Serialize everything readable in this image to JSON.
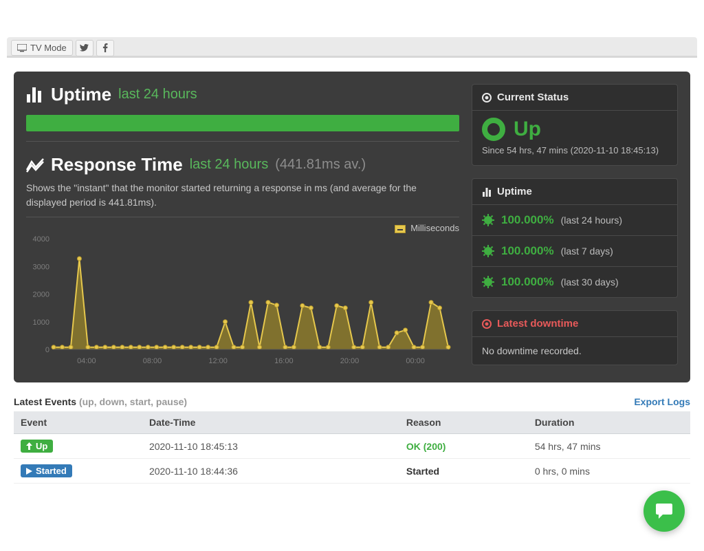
{
  "topbar": {
    "tv_mode": "TV Mode"
  },
  "uptime": {
    "title": "Uptime",
    "range": "last 24 hours"
  },
  "response": {
    "title": "Response Time",
    "range": "last 24 hours",
    "avg": "(441.81ms av.)",
    "desc": "Shows the \"instant\" that the monitor started returning a response in ms (and average for the displayed period is 441.81ms).",
    "legend": "Milliseconds"
  },
  "status": {
    "head": "Current Status",
    "label": "Up",
    "since": "Since 54 hrs, 47 mins (2020-11-10 18:45:13)"
  },
  "uptime_panel": {
    "head": "Uptime",
    "rows": [
      {
        "val": "100.000%",
        "range": "(last 24 hours)"
      },
      {
        "val": "100.000%",
        "range": "(last 7 days)"
      },
      {
        "val": "100.000%",
        "range": "(last 30 days)"
      }
    ]
  },
  "downtime": {
    "head": "Latest downtime",
    "body": "No downtime recorded."
  },
  "events": {
    "title": "Latest Events",
    "title_sub": "(up, down, start, pause)",
    "export": "Export Logs",
    "cols": {
      "event": "Event",
      "datetime": "Date-Time",
      "reason": "Reason",
      "duration": "Duration"
    },
    "rows": [
      {
        "badge_class": "green",
        "badge_icon": "up",
        "badge": "Up",
        "datetime": "2020-11-10 18:45:13",
        "reason": "OK (200)",
        "reason_class": "ok",
        "duration": "54 hrs, 47 mins"
      },
      {
        "badge_class": "blue",
        "badge_icon": "play",
        "badge": "Started",
        "datetime": "2020-11-10 18:44:36",
        "reason": "Started",
        "reason_class": "dark",
        "duration": "0 hrs, 0 mins"
      }
    ]
  },
  "chart_data": {
    "type": "line",
    "title": "Response Time last 24 hours",
    "ylabel": "Milliseconds",
    "xlabel": "",
    "ylim": [
      0,
      4000
    ],
    "yticks": [
      0,
      1000,
      2000,
      3000,
      4000
    ],
    "xticks": [
      "04:00",
      "08:00",
      "12:00",
      "16:00",
      "20:00",
      "00:00"
    ],
    "x": [
      "02:30",
      "03:00",
      "03:30",
      "04:00",
      "04:30",
      "05:00",
      "05:30",
      "06:00",
      "06:30",
      "07:00",
      "07:30",
      "08:00",
      "08:30",
      "09:00",
      "09:30",
      "10:00",
      "10:30",
      "11:00",
      "11:30",
      "12:00",
      "12:30",
      "13:00",
      "13:30",
      "14:00",
      "14:30",
      "15:00",
      "15:30",
      "16:00",
      "16:30",
      "17:00",
      "17:30",
      "18:00",
      "18:30",
      "19:00",
      "19:30",
      "20:00",
      "20:30",
      "21:00",
      "21:30",
      "22:00",
      "22:30",
      "23:00",
      "23:30",
      "00:00",
      "00:30",
      "01:00",
      "01:30"
    ],
    "values": [
      80,
      80,
      80,
      3280,
      80,
      80,
      80,
      80,
      80,
      80,
      80,
      80,
      80,
      80,
      80,
      80,
      80,
      80,
      80,
      80,
      1000,
      80,
      80,
      1700,
      80,
      1700,
      1600,
      80,
      80,
      1580,
      1500,
      80,
      80,
      1580,
      1500,
      80,
      80,
      1700,
      80,
      80,
      600,
      700,
      80,
      80,
      1700,
      1500,
      80
    ],
    "average_ms": 441.81
  }
}
